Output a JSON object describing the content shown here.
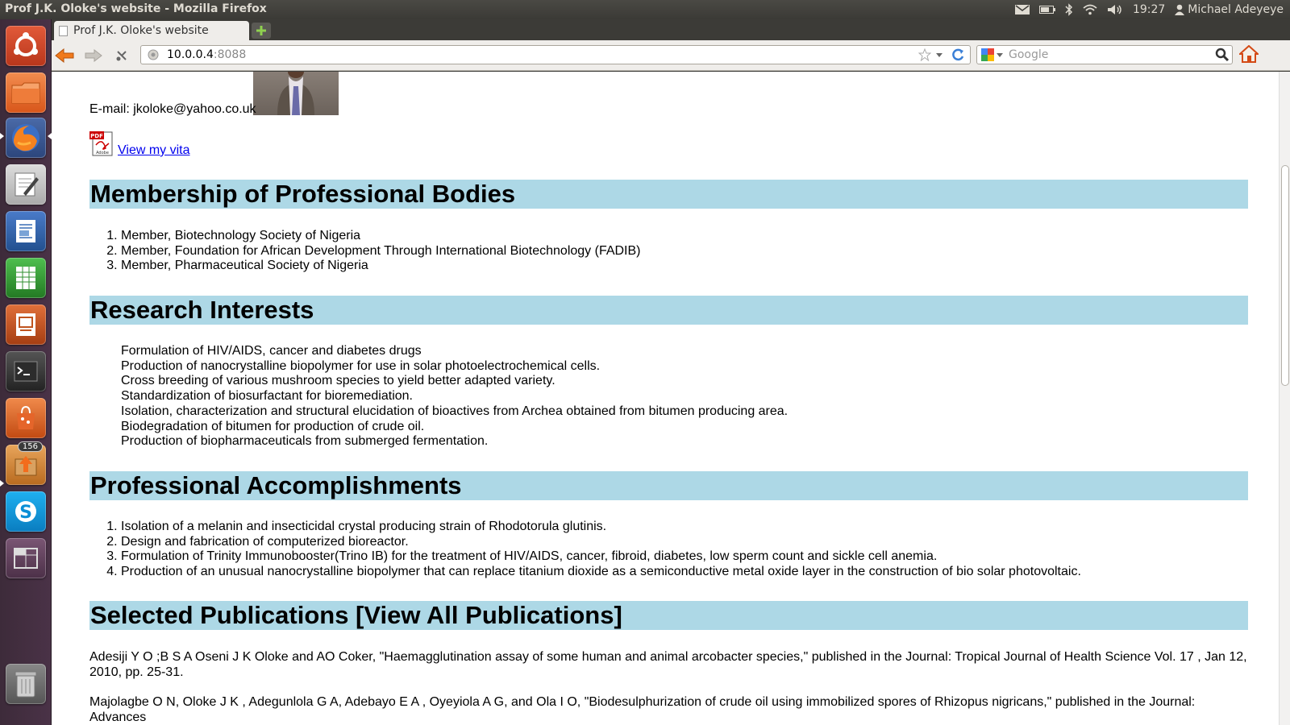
{
  "window": {
    "title": "Prof J.K. Oloke's website - Mozilla Firefox"
  },
  "panel": {
    "clock": "19:27",
    "user": "Michael Adeyeye"
  },
  "launcher": {
    "badge_count": "156"
  },
  "browser": {
    "tab_title": "Prof J.K. Oloke's website",
    "url_host": "10.0.0.4",
    "url_port": ":8088",
    "search_placeholder": "Google"
  },
  "page": {
    "email": "E-mail: jkoloke@yahoo.co.uk",
    "vita_link": "View my vita",
    "membership": {
      "heading": "Membership of Professional Bodies",
      "items": [
        "Member, Biotechnology Society of Nigeria",
        "Member, Foundation for African Development Through International Biotechnology (FADIB)",
        "Member, Pharmaceutical Society of Nigeria"
      ]
    },
    "research": {
      "heading": "Research Interests",
      "items": [
        "Formulation of HIV/AIDS, cancer and diabetes drugs",
        "Production of nanocrystalline biopolymer for use in solar photoelectrochemical cells.",
        "Cross breeding of various mushroom species to yield better adapted variety.",
        "Standardization of biosurfactant for bioremediation.",
        "Isolation, characterization and structural elucidation of bioactives from Archea obtained from bitumen producing area.",
        "Biodegradation of bitumen for production of crude oil.",
        "Production of biopharmaceuticals from submerged fermentation."
      ]
    },
    "accomplishments": {
      "heading": "Professional Accomplishments",
      "items": [
        "Isolation of a melanin and insecticidal crystal producing strain of Rhodotorula glutinis.",
        "Design and fabrication of computerized bioreactor.",
        "Formulation of Trinity Immunobooster(Trino IB) for the treatment of HIV/AIDS, cancer, fibroid, diabetes, low sperm count and sickle cell anemia.",
        "Production of an unusual nanocrystalline biopolymer that can replace titanium dioxide as a semiconductive metal oxide layer in the construction of bio solar photovoltaic."
      ]
    },
    "publications": {
      "heading": "Selected Publications [View All Publications]",
      "items": [
        "Adesiji Y O ;B S A Oseni J K Oloke and AO Coker,  \"Haemagglutination assay of some human and animal arcobacter species,\"  published in the Journal: Tropical Journal of Health Science Vol. 17 , Jan 12, 2010, pp. 25-31.",
        "Majolagbe O N, Oloke J K , Adegunlola G A, Adebayo E A , Oyeyiola A G, and Ola I O,  \"Biodesulphurization of crude oil using immobilized spores of Rhizopus nigricans,\"  published in the Journal: Advances"
      ]
    }
  }
}
